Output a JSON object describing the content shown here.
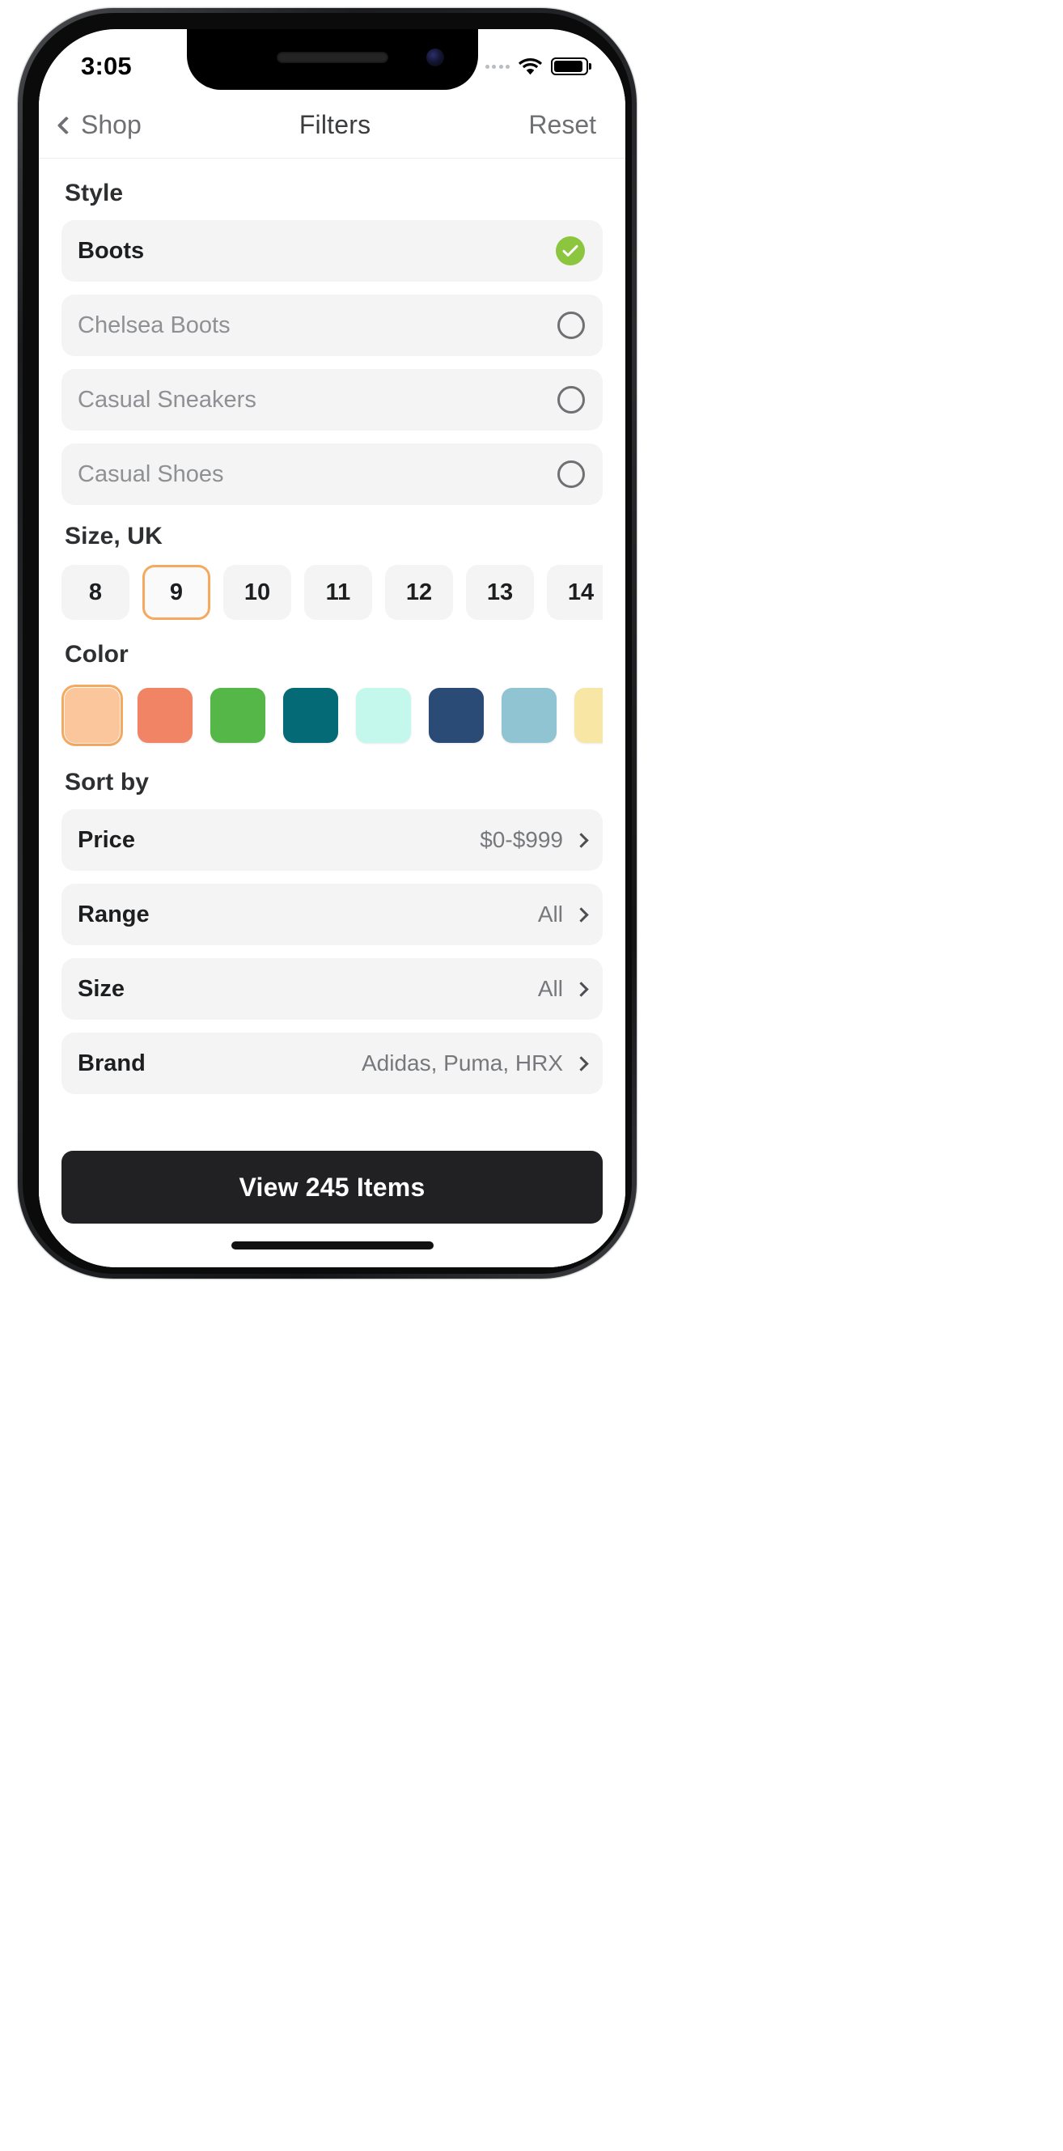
{
  "status_bar": {
    "time": "3:05",
    "cellular_icon": "cellular-dots-icon",
    "wifi_icon": "wifi-icon",
    "battery_icon": "battery-icon"
  },
  "nav": {
    "back_icon": "chevron-left-icon",
    "back_label": "Shop",
    "title": "Filters",
    "reset_label": "Reset"
  },
  "sections": {
    "style_title": "Style",
    "size_title": "Size, UK",
    "color_title": "Color",
    "sort_title": "Sort by"
  },
  "style_options": [
    {
      "label": "Boots",
      "selected": true,
      "control_icon": "check-circle-icon"
    },
    {
      "label": "Chelsea Boots",
      "selected": false,
      "control_icon": "radio-empty-icon"
    },
    {
      "label": "Casual Sneakers",
      "selected": false,
      "control_icon": "radio-empty-icon"
    },
    {
      "label": "Casual Shoes",
      "selected": false,
      "control_icon": "radio-empty-icon"
    }
  ],
  "sizes": [
    {
      "label": "8",
      "selected": false
    },
    {
      "label": "9",
      "selected": true
    },
    {
      "label": "10",
      "selected": false
    },
    {
      "label": "11",
      "selected": false
    },
    {
      "label": "12",
      "selected": false
    },
    {
      "label": "13",
      "selected": false
    },
    {
      "label": "14",
      "selected": false
    }
  ],
  "colors": [
    {
      "name": "peach",
      "hex": "#FCC69C",
      "selected": true
    },
    {
      "name": "salmon",
      "hex": "#F08465",
      "selected": false
    },
    {
      "name": "green",
      "hex": "#55B748",
      "selected": false
    },
    {
      "name": "teal",
      "hex": "#046A76",
      "selected": false
    },
    {
      "name": "mint",
      "hex": "#C5F8EC",
      "selected": false
    },
    {
      "name": "navy",
      "hex": "#2B4B77",
      "selected": false
    },
    {
      "name": "light-blue",
      "hex": "#90C4D2",
      "selected": false
    },
    {
      "name": "pale-yellow",
      "hex": "#F8E7A4",
      "selected": false
    }
  ],
  "sort_rows": [
    {
      "label": "Price",
      "value": "$0-$999",
      "chevron_icon": "chevron-right-icon"
    },
    {
      "label": "Range",
      "value": "All",
      "chevron_icon": "chevron-right-icon"
    },
    {
      "label": "Size",
      "value": "All",
      "chevron_icon": "chevron-right-icon"
    },
    {
      "label": "Brand",
      "value": "Adidas, Puma, HRX",
      "chevron_icon": "chevron-right-icon"
    }
  ],
  "cta": {
    "label": "View 245 Items"
  },
  "accent_colors": {
    "selected_check": "#8CC63E",
    "selected_outline": "#F5A95E",
    "cta_background": "#212123",
    "row_background": "#F4F4F4"
  }
}
